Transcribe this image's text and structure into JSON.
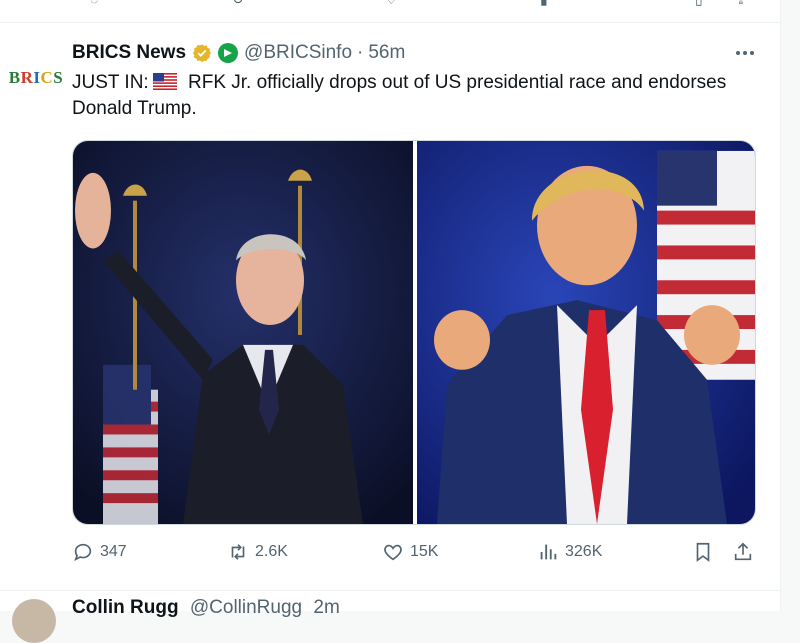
{
  "tweet": {
    "display_name": "BRICS News",
    "handle": "@BRICSinfo",
    "separator": "·",
    "time": "56m",
    "text_prefix": "JUST IN:",
    "text_body": " RFK Jr. officially drops out of US presidential race and endorses Donald Trump.",
    "avatar_text": "BRICS",
    "avatar_colors": [
      "#2a7a3a",
      "#d23a2a",
      "#1f6fb2",
      "#d9a21b",
      "#2a7a3a"
    ],
    "actions": {
      "replies": "347",
      "reposts": "2.6K",
      "likes": "15K",
      "views": "326K"
    }
  },
  "next_tweet": {
    "display_name": "Collin Rugg",
    "handle": "@CollinRugg",
    "time": "2m"
  },
  "colors": {
    "text": "#0f1419",
    "muted": "#536471",
    "verified_gold": "#e5b52a",
    "verified_blue": "#1d9bf0"
  },
  "icons": [
    "more-icon",
    "reply-icon",
    "repost-icon",
    "like-icon",
    "views-icon",
    "bookmark-icon",
    "share-icon",
    "verified-gold-icon",
    "affiliate-badge-icon",
    "us-flag-icon"
  ]
}
